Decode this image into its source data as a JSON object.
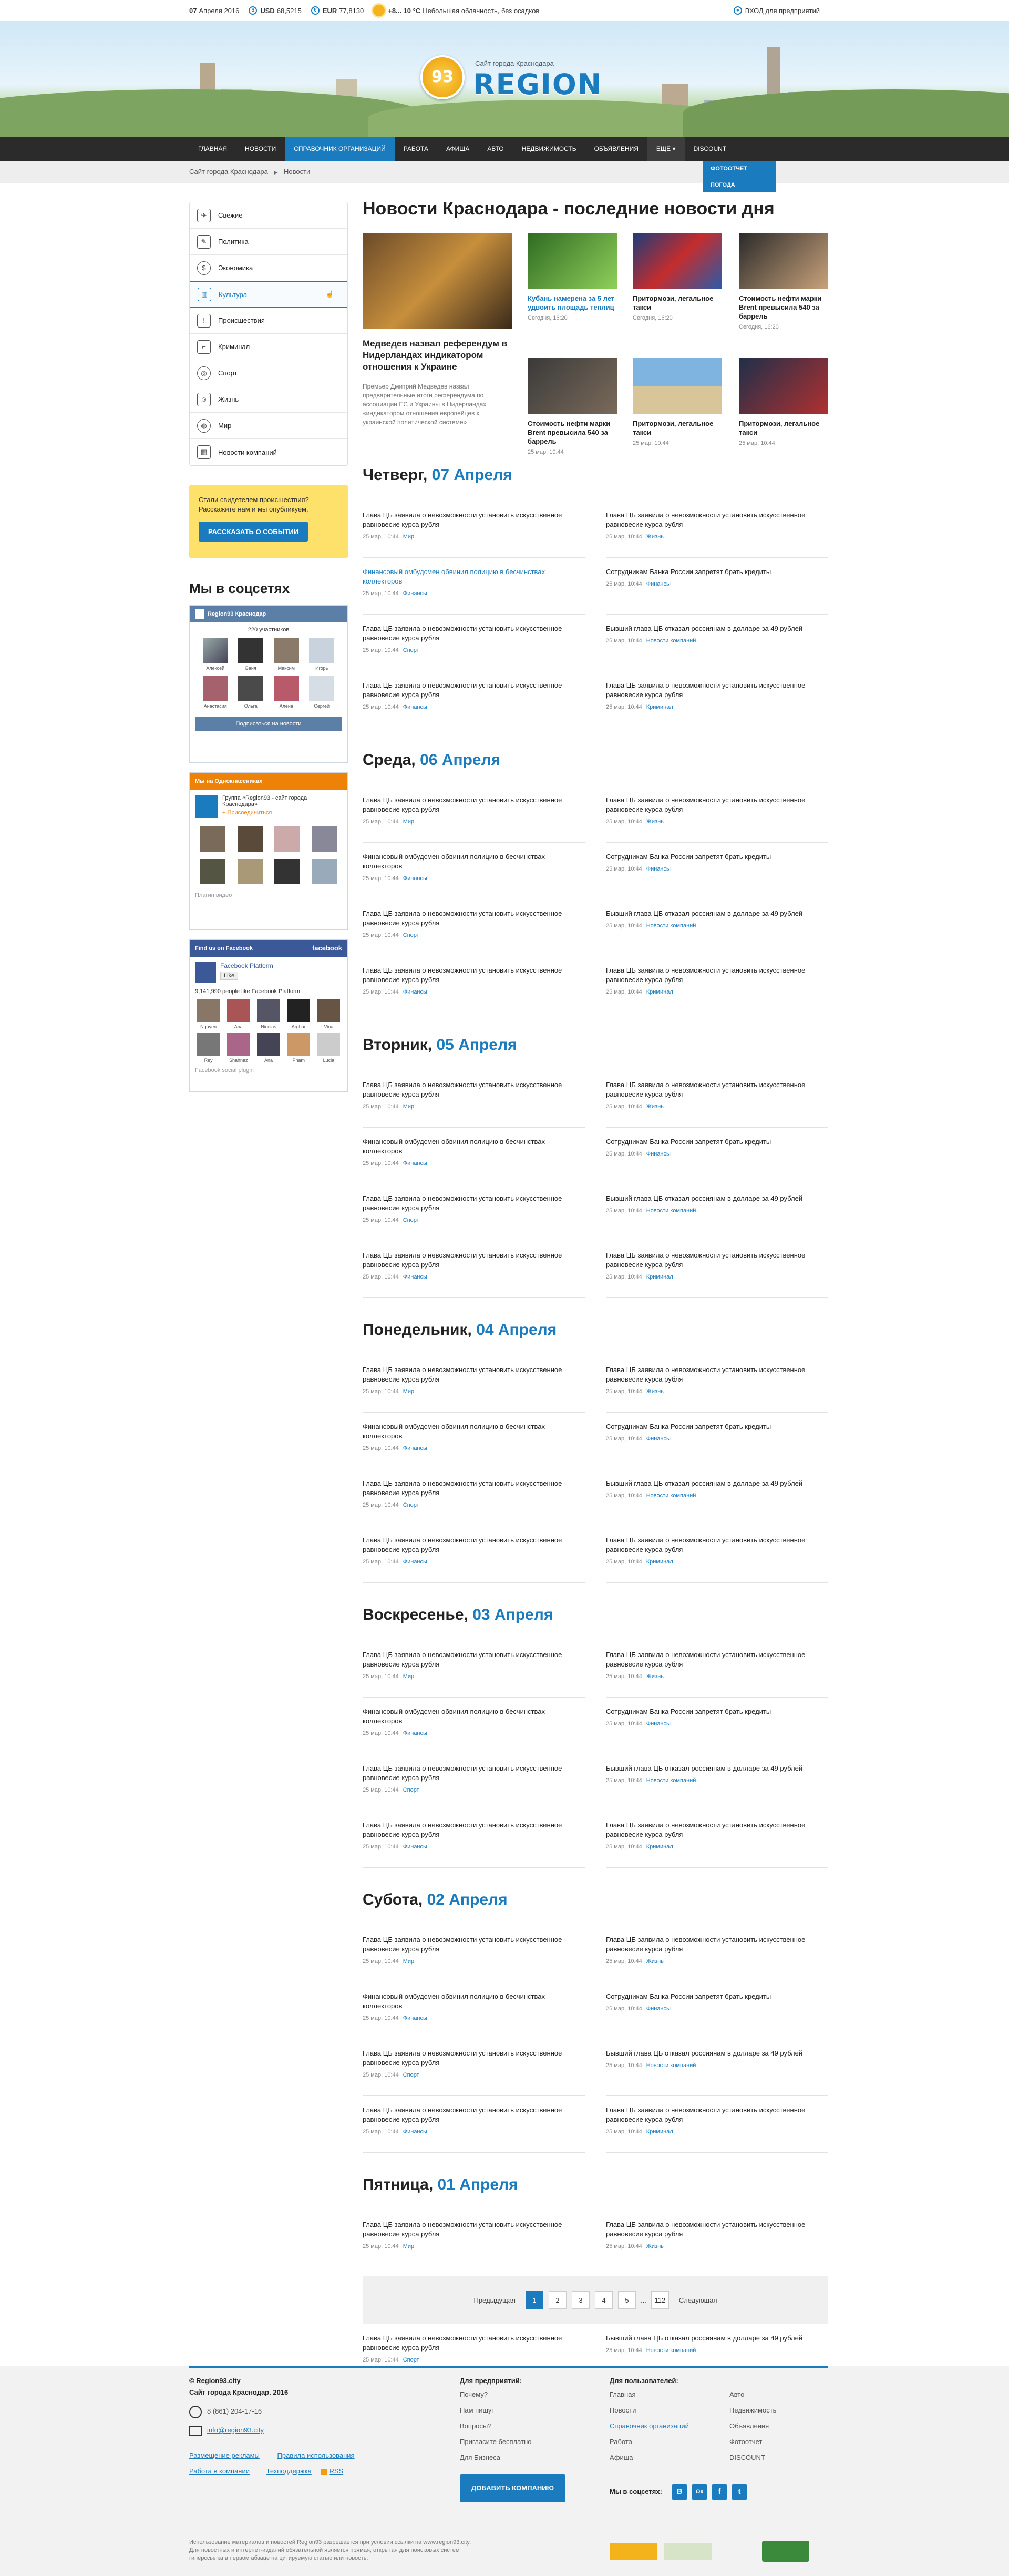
{
  "topbar": {
    "date_day": "07",
    "date_rest": "Апреля 2016",
    "usd_label": "USD",
    "usd": "68,5215",
    "eur_label": "EUR",
    "eur": "77,8130",
    "temp": "+8... 10 °С",
    "weather": "Небольшая облачность, без осадков",
    "login": "ВХОД для предприятий"
  },
  "logo": {
    "badge": "93",
    "tagline": "Сайт города Краснодара",
    "word": "REGION"
  },
  "nav": [
    "ГЛАВНАЯ",
    "НОВОСТИ",
    "СПРАВОЧНИК ОРГАНИЗАЦИЙ",
    "РАБОТА",
    "АФИША",
    "АВТО",
    "НЕДВИЖИМОСТЬ",
    "ОБЪЯВЛЕНИЯ",
    "ЕЩЁ",
    "DISCOUNT"
  ],
  "dropdown": [
    "ФОТООТЧЕТ",
    "ПОГОДА"
  ],
  "breadcrumb": {
    "home": "Сайт города Краснодара",
    "sep": "▶",
    "current": "Новости"
  },
  "rubrics": [
    "Свежие",
    "Политика",
    "Экономика",
    "Культура",
    "Происшествия",
    "Криминал",
    "Спорт",
    "Жизнь",
    "Мир",
    "Новости компаний"
  ],
  "witness": {
    "text": "Стали свидетелем происшествия? Расскажите нам и мы опубликуем.",
    "button": "РАССКАЗАТЬ О СОБЫТИИ"
  },
  "social": {
    "title": "Мы в соцсетях",
    "vk_head": "Region93 Краснодар",
    "vk_count": "220 участников",
    "vk_names": [
      "Алексей",
      "Ваня",
      "Максим",
      "Игорь",
      "Анастасия",
      "Ольга",
      "Алёна",
      "Сергей"
    ],
    "vk_btn": "Подписаться на новости",
    "ok_head": "Мы на Одноклассниках",
    "ok_group": "Группа «Region93 - сайт города Краснодара»",
    "ok_join": "+ Присоединиться",
    "ok_foot": "Плагин видео",
    "fb_head": "Find us on Facebook",
    "fb_brand": "facebook",
    "fb_page": "Facebook Platform",
    "fb_like": "Like",
    "fb_count": "9,141,990 people like Facebook Platform.",
    "fb_names": [
      "Nguyen",
      "Ana",
      "Nicolas",
      "Arghar",
      "Vina",
      "Rey",
      "Shahnaz",
      "Ana",
      "Pham",
      "Lucia"
    ],
    "fb_foot": "Facebook social plugin"
  },
  "main": {
    "title": "Новости Краснодара - последние новости дня",
    "big": {
      "title": "Медведев назвал референдум в Нидерландах индикатором отношения к Украине",
      "desc": "Премьер Дмитрий Медведев назвал предварительные итоги референдума по ассоциации ЕС и Украины в Нидерландах «индикатором отношения европейцев к украинской политической системе»"
    },
    "small": [
      {
        "title": "Кубань намерена за 5 лет удвоить площадь теплиц",
        "date": "Сегодня, 16:20"
      },
      {
        "title": "Притормози, легальное такси",
        "date": "Сегодня, 16:20"
      },
      {
        "title": "Стоимость нефти марки Brent превысила 540 за баррель",
        "date": "Сегодня, 16:20"
      },
      {
        "title": "Стоимость нефти марки Brent превысила 540 за баррель",
        "date": "25 мар, 10:44"
      },
      {
        "title": "Притормози, легальное такси",
        "date": "25 мар, 10:44"
      },
      {
        "title": "Притормози, легальное такси",
        "date": "25 мар, 10:44"
      }
    ]
  },
  "days": [
    {
      "name": "Четверг,",
      "date": "07 Апреля"
    },
    {
      "name": "Среда,",
      "date": "06 Апреля"
    },
    {
      "name": "Вторник,",
      "date": "05 Апреля"
    },
    {
      "name": "Понедельник,",
      "date": "04 Апреля"
    },
    {
      "name": "Воскресенье,",
      "date": "03 Апреля"
    },
    {
      "name": "Субота,",
      "date": "02 Апреля"
    },
    {
      "name": "Пятница,",
      "date": "01 Апреля"
    }
  ],
  "news_items": [
    {
      "title": "Глава ЦБ заявила о невозможности установить искусственное равновесие курса рубля",
      "time": "25 мар, 10:44",
      "cat": "Мир"
    },
    {
      "title": "Глава ЦБ заявила о невозможности установить искусственное равновесие курса рубля",
      "time": "25 мар, 10:44",
      "cat": "Жизнь"
    },
    {
      "title": "Финансовый омбудсмен обвинил полицию в бесчинствах коллекторов",
      "time": "25 мар, 10:44",
      "cat": "Финансы"
    },
    {
      "title": "Сотрудникам Банка России запретят брать кредиты",
      "time": "25 мар, 10:44",
      "cat": "Финансы"
    },
    {
      "title": "Глава ЦБ заявила о невозможности установить искусственное равновесие курса рубля",
      "time": "25 мар, 10:44",
      "cat": "Спорт"
    },
    {
      "title": "Бывший глава ЦБ отказал россиянам в долларе за 49 рублей",
      "time": "25 мар, 10:44",
      "cat": "Новости компаний"
    },
    {
      "title": "Глава ЦБ заявила о невозможности установить искусственное равновесие курса рубля",
      "time": "25 мар, 10:44",
      "cat": "Финансы"
    },
    {
      "title": "Глава ЦБ заявила о невозможности установить искусственное равновесие курса рубля",
      "time": "25 мар, 10:44",
      "cat": "Криминал"
    }
  ],
  "pager": {
    "prev": "Предыдущая",
    "pages": [
      "1",
      "2",
      "3",
      "4",
      "5"
    ],
    "dots": "...",
    "last": "112",
    "next": "Следующая"
  },
  "footer": {
    "copy": "© Region93.city",
    "site": "Сайт города Краснодар. 2016",
    "phone": "8 (861) 204-17-16",
    "email": "info@region93.city",
    "links_left": [
      "Размещение рекламы",
      "Правила использования",
      "Работа в компании",
      "Техподдержка",
      "RSS"
    ],
    "biz_head": "Для предприятий:",
    "biz": [
      "Почему?",
      "Нам пишут",
      "Вопросы?",
      "Пригласите бесплатно",
      "Для Бизнеса"
    ],
    "biz_btn": "ДОБАВИТЬ КОМПАНИЮ",
    "users_head": "Для пользователей:",
    "users1": [
      "Главная",
      "Новости",
      "Справочник организаций",
      "Работа",
      "Афиша"
    ],
    "users2": [
      "Авто",
      "Недвижимость",
      "Объявления",
      "Фотоотчет",
      "DISCOUNT"
    ],
    "social_label": "Мы в соцсетях:",
    "social": [
      "В",
      "Ок",
      "f",
      "t"
    ],
    "disclaimer1": "Использование материалов и новостей Region93 разрешается при условии ссылки на www.region93.city.",
    "disclaimer2": "Для новостных и интернет-изданий обязательной является прямая, открытая для поисковых систем",
    "disclaimer3": "гиперссылка в первом абзаце на цитируемую статью или новость."
  }
}
